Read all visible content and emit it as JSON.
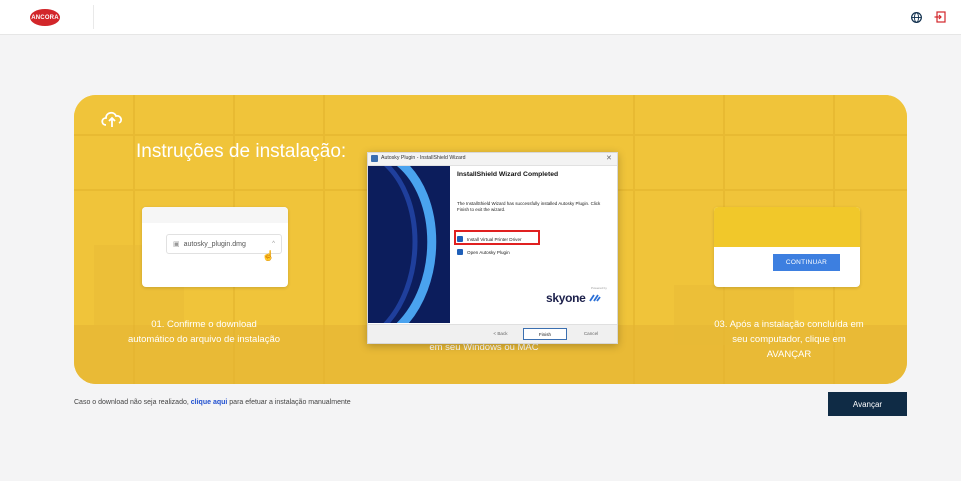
{
  "header": {
    "logo_text": "ANCORA",
    "icons": {
      "language": "globe-icon",
      "exit": "logout-icon"
    }
  },
  "colors": {
    "card_yellow": "#f0c43a",
    "button_navy": "#0f2b45",
    "link_blue": "#1f4fd0",
    "logo_red": "#d2262a",
    "highlight_red": "#e02020"
  },
  "card": {
    "title": "Instruções de instalação:",
    "step1": {
      "download_filename": "autosky_plugin.dmg",
      "text": "01. Confirme o download automático do arquivo de instalação"
    },
    "step2": {
      "text": "em seu Windows ou MAC",
      "dialog": {
        "window_title": "Autosky Plugin - InstallShield Wizard",
        "heading": "InstallShield Wizard Completed",
        "body": "The InstallShield Wizard has successfully installed Autosky Plugin. Click Finish to exit the wizard.",
        "checkbox1": "Install Virtual Printer Driver",
        "checkbox2": "Open Autosky Plugin",
        "powered_by": "Powered by",
        "brand": "skyone",
        "back": "< Back",
        "finish": "Finish",
        "cancel": "Cancel"
      }
    },
    "step3": {
      "button": "CONTINUAR",
      "text": "03. Após a instalação concluída em seu computador, clique em AVANÇAR"
    }
  },
  "footer": {
    "hint_prefix": "Caso o download não seja realizado,",
    "hint_link": "clique aqui",
    "hint_suffix": "para efetuar a instalação manualmente",
    "next_button": "Avançar"
  }
}
